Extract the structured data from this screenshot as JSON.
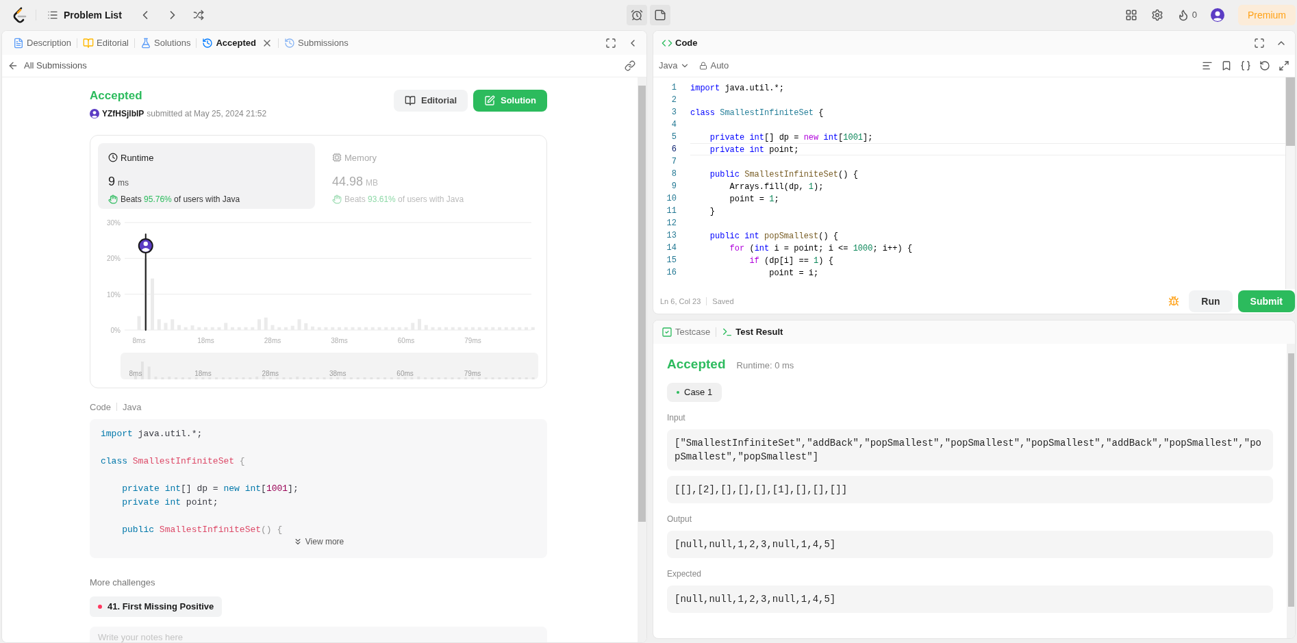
{
  "top_bar": {
    "problem_list": "Problem List",
    "streak_count": "0",
    "premium": "Premium"
  },
  "left_panel": {
    "tabs": [
      {
        "label": "Description",
        "kind": "description",
        "selected": false,
        "closable": false
      },
      {
        "label": "Editorial",
        "kind": "editorial",
        "selected": false,
        "closable": false
      },
      {
        "label": "Solutions",
        "kind": "solutions",
        "selected": false,
        "closable": false
      },
      {
        "label": "Accepted",
        "kind": "accepted",
        "selected": true,
        "closable": true
      },
      {
        "label": "Submissions",
        "kind": "submissions",
        "selected": false,
        "closable": false
      }
    ],
    "back_link": "All Submissions",
    "submission": {
      "status": "Accepted",
      "user": "YZfHSjlbIP",
      "submitted_at": "submitted at May 25, 2024 21:52",
      "editorial_button": "Editorial",
      "solution_button": "Solution"
    },
    "stats": [
      {
        "kind": "runtime",
        "title": "Runtime",
        "value": "9",
        "unit": "ms",
        "beats": "Beats",
        "percent": "95.76%",
        "suffix": "of users with Java",
        "selected": true
      },
      {
        "kind": "memory",
        "title": "Memory",
        "value": "44.98",
        "unit": "MB",
        "beats": "Beats",
        "percent": "93.61%",
        "suffix": "of users with Java",
        "selected": false
      }
    ],
    "chart_data": {
      "type": "bar",
      "ylim": [
        0,
        30
      ],
      "yticks": [
        {
          "value": 0,
          "label": "0%"
        },
        {
          "value": 10,
          "label": "10%"
        },
        {
          "value": 20,
          "label": "20%"
        },
        {
          "value": 30,
          "label": "30%"
        }
      ],
      "categories": [
        "8ms",
        null,
        null,
        null,
        null,
        null,
        null,
        null,
        null,
        null,
        "18ms",
        null,
        null,
        null,
        null,
        null,
        null,
        null,
        null,
        null,
        "28ms",
        null,
        null,
        null,
        null,
        null,
        null,
        null,
        null,
        null,
        "38ms",
        null,
        null,
        null,
        null,
        null,
        null,
        null,
        null,
        null,
        "60ms",
        null,
        null,
        null,
        null,
        null,
        null,
        null,
        null,
        null,
        "79ms",
        null,
        null,
        null,
        null,
        null,
        null,
        null,
        null,
        null
      ],
      "values": [
        3.9,
        20,
        14.4,
        3,
        2,
        3,
        1.4,
        0.8,
        1.3,
        0.8,
        0.8,
        0.8,
        0.8,
        2,
        0.8,
        0.8,
        0.8,
        0.8,
        3,
        3.5,
        1.4,
        0.8,
        0.8,
        1.2,
        3,
        1.9,
        1,
        0.8,
        0.8,
        0.8,
        0.8,
        0.8,
        0.8,
        0.8,
        0.8,
        0.8,
        0.8,
        0.8,
        0.8,
        0.8,
        0.8,
        2,
        3.1,
        1.4,
        0.8,
        0.8,
        0.8,
        0.8,
        0.8,
        0.8,
        0.8,
        0.8,
        0.8,
        0.8,
        0.8,
        0.8,
        0.8,
        0.8,
        0.8,
        0.8
      ]
    },
    "brush_labels": [
      "8ms",
      "18ms",
      "28ms",
      "38ms",
      "60ms",
      "79ms"
    ],
    "code_header": {
      "label": "Code",
      "language": "Java"
    },
    "code_preview": [
      {
        "kind": "code",
        "tokens": [
          {
            "text": "import",
            "kind": "keyword"
          },
          {
            "text": " java.util.*;",
            "kind": "plain"
          }
        ]
      },
      {
        "kind": "blank"
      },
      {
        "kind": "code",
        "tokens": [
          {
            "text": "class ",
            "kind": "keyword"
          },
          {
            "text": "SmallestInfiniteSet",
            "kind": "type"
          },
          {
            "text": " {",
            "kind": "punct"
          }
        ]
      },
      {
        "kind": "blank"
      },
      {
        "kind": "code",
        "tokens": [
          {
            "text": "    private ",
            "kind": "keyword"
          },
          {
            "text": "int",
            "kind": "keyword"
          },
          {
            "text": "[] dp = ",
            "kind": "plain"
          },
          {
            "text": "new ",
            "kind": "control"
          },
          {
            "text": "int",
            "kind": "keyword"
          },
          {
            "text": "[",
            "kind": "plain"
          },
          {
            "text": "1001",
            "kind": "number"
          },
          {
            "text": "];",
            "kind": "plain"
          }
        ]
      },
      {
        "kind": "code",
        "tokens": [
          {
            "text": "    private int",
            "kind": "keyword"
          },
          {
            "text": " point;",
            "kind": "plain"
          }
        ]
      },
      {
        "kind": "blank"
      },
      {
        "kind": "code",
        "tokens": [
          {
            "text": "    public ",
            "kind": "keyword"
          },
          {
            "text": "SmallestInfiniteSet",
            "kind": "function"
          },
          {
            "text": "() {",
            "kind": "punct"
          }
        ]
      }
    ],
    "view_more": "View more",
    "more_challenges": {
      "title": "More challenges",
      "items": [
        {
          "label": "41. First Missing Positive",
          "color": "#ff375f"
        }
      ]
    },
    "notes": {
      "placeholder": "Write your notes here"
    }
  },
  "editor": {
    "title": "Code",
    "language": "Java",
    "mode": "Auto",
    "lines": [
      {
        "n": "1",
        "kind": "code",
        "selected": false,
        "tokens": [
          {
            "text": "import",
            "kind": "keyword"
          },
          {
            "text": " java.util.*;",
            "kind": "plain"
          }
        ]
      },
      {
        "n": "2",
        "kind": "blank",
        "selected": false
      },
      {
        "n": "3",
        "kind": "code",
        "selected": false,
        "tokens": [
          {
            "text": "class ",
            "kind": "keyword"
          },
          {
            "text": "SmallestInfiniteSet",
            "kind": "type"
          },
          {
            "text": " {",
            "kind": "plain"
          }
        ]
      },
      {
        "n": "4",
        "kind": "blank",
        "selected": false
      },
      {
        "n": "5",
        "kind": "code",
        "selected": false,
        "tokens": [
          {
            "text": "    private ",
            "kind": "keyword"
          },
          {
            "text": "int",
            "kind": "keyword"
          },
          {
            "text": "[] dp = ",
            "kind": "plain"
          },
          {
            "text": "new ",
            "kind": "control"
          },
          {
            "text": "int",
            "kind": "keyword"
          },
          {
            "text": "[",
            "kind": "plain"
          },
          {
            "text": "1001",
            "kind": "number"
          },
          {
            "text": "];",
            "kind": "plain"
          }
        ]
      },
      {
        "n": "6",
        "kind": "code",
        "selected": true,
        "tokens": [
          {
            "text": "    private int",
            "kind": "keyword"
          },
          {
            "text": " point;",
            "kind": "plain"
          }
        ]
      },
      {
        "n": "7",
        "kind": "blank",
        "selected": false
      },
      {
        "n": "8",
        "kind": "code",
        "selected": false,
        "tokens": [
          {
            "text": "    public ",
            "kind": "keyword"
          },
          {
            "text": "SmallestInfiniteSet",
            "kind": "function"
          },
          {
            "text": "() {",
            "kind": "plain"
          }
        ]
      },
      {
        "n": "9",
        "kind": "code",
        "selected": false,
        "tokens": [
          {
            "text": "        Arrays.fill(dp, ",
            "kind": "plain"
          },
          {
            "text": "1",
            "kind": "number"
          },
          {
            "text": ");",
            "kind": "plain"
          }
        ]
      },
      {
        "n": "10",
        "kind": "code",
        "selected": false,
        "tokens": [
          {
            "text": "        point = ",
            "kind": "plain"
          },
          {
            "text": "1",
            "kind": "number"
          },
          {
            "text": ";",
            "kind": "plain"
          }
        ]
      },
      {
        "n": "11",
        "kind": "code",
        "selected": false,
        "tokens": [
          {
            "text": "    }",
            "kind": "plain"
          }
        ]
      },
      {
        "n": "12",
        "kind": "blank",
        "selected": false
      },
      {
        "n": "13",
        "kind": "code",
        "selected": false,
        "tokens": [
          {
            "text": "    public int ",
            "kind": "keyword"
          },
          {
            "text": "popSmallest",
            "kind": "function"
          },
          {
            "text": "() {",
            "kind": "plain"
          }
        ]
      },
      {
        "n": "14",
        "kind": "code",
        "selected": false,
        "tokens": [
          {
            "text": "        for",
            "kind": "control"
          },
          {
            "text": " (",
            "kind": "plain"
          },
          {
            "text": "int",
            "kind": "keyword"
          },
          {
            "text": " i = point; i <= ",
            "kind": "plain"
          },
          {
            "text": "1000",
            "kind": "number"
          },
          {
            "text": "; i++) {",
            "kind": "plain"
          }
        ]
      },
      {
        "n": "15",
        "kind": "code",
        "selected": false,
        "tokens": [
          {
            "text": "            if",
            "kind": "control"
          },
          {
            "text": " (dp[i] == ",
            "kind": "plain"
          },
          {
            "text": "1",
            "kind": "number"
          },
          {
            "text": ") {",
            "kind": "plain"
          }
        ]
      },
      {
        "n": "16",
        "kind": "code",
        "selected": false,
        "tokens": [
          {
            "text": "                point = i;",
            "kind": "plain"
          }
        ]
      }
    ],
    "cursor": "Ln 6, Col 23",
    "saved": "Saved",
    "run": "Run",
    "submit": "Submit"
  },
  "test_panel": {
    "tabs": [
      {
        "label": "Testcase",
        "kind": "testcase",
        "selected": false
      },
      {
        "label": "Test Result",
        "kind": "result",
        "selected": true
      }
    ],
    "verdict": "Accepted",
    "runtime": "Runtime: 0 ms",
    "cases": [
      {
        "label": "Case 1",
        "selected": true,
        "color": "#2cbb5d"
      }
    ],
    "sections": [
      {
        "label": "Input",
        "values": [
          "[\"SmallestInfiniteSet\",\"addBack\",\"popSmallest\",\"popSmallest\",\"popSmallest\",\"addBack\",\"popSmallest\",\"popSmallest\",\"popSmallest\"]",
          "[[],[2],[],[],[],[1],[],[],[]]"
        ]
      },
      {
        "label": "Output",
        "values": [
          "[null,null,1,2,3,null,1,4,5]"
        ]
      },
      {
        "label": "Expected",
        "values": [
          "[null,null,1,2,3,null,1,4,5]"
        ]
      }
    ]
  }
}
